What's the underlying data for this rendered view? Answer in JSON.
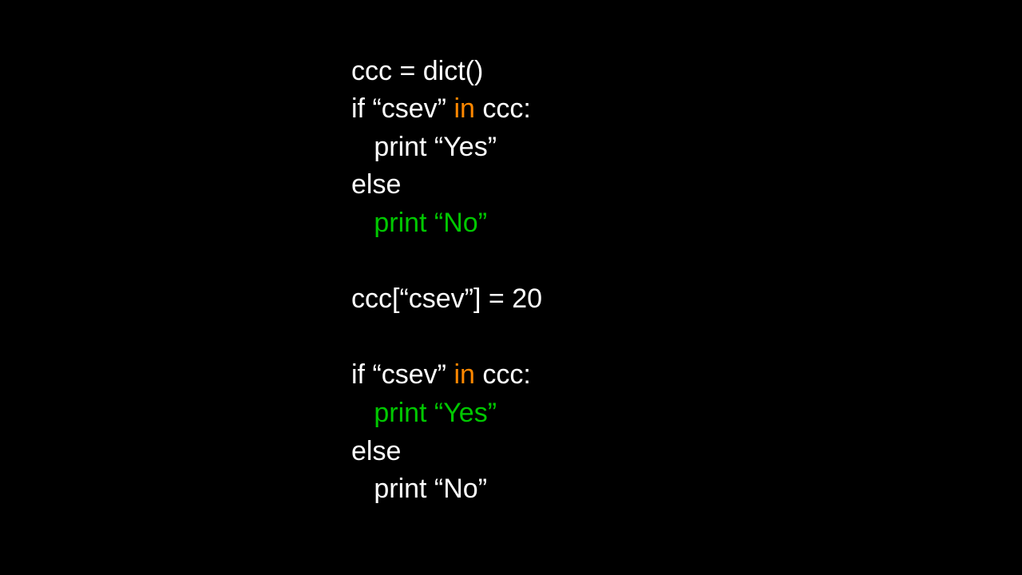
{
  "code": {
    "l1": "ccc = dict()",
    "l2a": "if “csev” ",
    "l2b": "in",
    "l2c": " ccc:",
    "l3": "   print “Yes”",
    "l4": "else",
    "l5": "   print “No”",
    "l6": "",
    "l7": "ccc[“csev”] = 20",
    "l8": "",
    "l9a": "if “csev” ",
    "l9b": "in",
    "l9c": " ccc:",
    "l10": "   print “Yes”",
    "l11": "else",
    "l12": "   print “No”"
  },
  "colors": {
    "background": "#000000",
    "default_text": "#ffffff",
    "keyword": "#ff8800",
    "execution_highlight": "#00c800"
  }
}
